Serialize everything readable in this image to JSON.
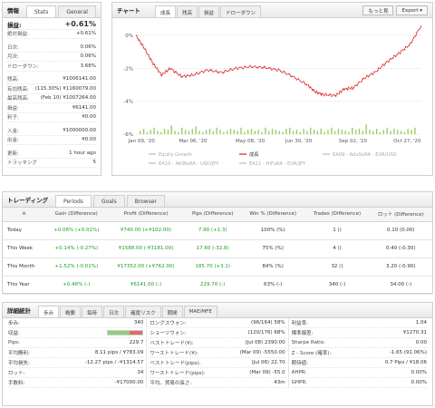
{
  "info": {
    "title": "情報",
    "tabs": [
      "Stats",
      "General"
    ],
    "rows": [
      {
        "k": "損益:",
        "v": "+0.61%",
        "style": "big"
      },
      {
        "k": "絶対損益:",
        "v": "+0.61%",
        "style": "green"
      },
      {
        "k": "",
        "v": "",
        "style": "gap"
      },
      {
        "k": "日次:",
        "v": "0.06%"
      },
      {
        "k": "月次:",
        "v": "0.06%"
      },
      {
        "k": "ドローダウン:",
        "v": "3.68%"
      },
      {
        "k": "",
        "v": "",
        "style": "gap"
      },
      {
        "k": "残高:",
        "v": "¥1006141.00"
      },
      {
        "k": "有効残高:",
        "v": "(115.30%) ¥1160079.00"
      },
      {
        "k": "最高残高:",
        "v": "(Feb 10) ¥1007264.00"
      },
      {
        "k": "損益:",
        "v": "¥6141.00",
        "style": "green"
      },
      {
        "k": "利子:",
        "v": "¥0.00"
      },
      {
        "k": "",
        "v": "",
        "style": "gap"
      },
      {
        "k": "入金:",
        "v": "¥1000000.00"
      },
      {
        "k": "出金:",
        "v": "¥0.00"
      },
      {
        "k": "",
        "v": "",
        "style": "gap"
      },
      {
        "k": "更新:",
        "v": "1 hour ago"
      },
      {
        "k": "トラッキング",
        "v": "5"
      }
    ]
  },
  "chart": {
    "title": "チャート",
    "tabs": [
      "成長",
      "残高",
      "損益",
      "ドローダウン"
    ],
    "tools": [
      "もっと見",
      "Export ▾"
    ],
    "legend": [
      "Equity Growth",
      "成長",
      "EA09 - AduSoRA - EUR/USD",
      "EA10 - AKIBeRA - USD/JPY",
      "EA11 - HiFuRA - EUR/JPY"
    ],
    "colors": {
      "line": "#d8201f",
      "bars": "#9ccc65",
      "grid": "#e6e6e6"
    }
  },
  "chart_data": {
    "type": "line",
    "x_ticks": [
      "Jan 09, '20",
      "Mar 06, '20",
      "May 08, '20",
      "Jun 30, '20",
      "Sep 02, '20",
      "Oct 27, '20"
    ],
    "y_ticks": [
      "0%",
      "-2%",
      "-4%",
      "-6%"
    ],
    "ylim": [
      -6,
      0.61
    ],
    "series": [
      {
        "name": "成長",
        "x": [
          0,
          3,
          6,
          9,
          12,
          16,
          20,
          25,
          30,
          35,
          40,
          45,
          50,
          55,
          60,
          63,
          66,
          70,
          73,
          76,
          80,
          84,
          88,
          92,
          96,
          100
        ],
        "values": [
          0.0,
          -0.8,
          -1.7,
          -2.4,
          -2.0,
          -2.5,
          -2.4,
          -2.1,
          -2.25,
          -2.0,
          -1.9,
          -1.95,
          -2.1,
          -2.5,
          -3.0,
          -3.45,
          -3.6,
          -3.65,
          -3.25,
          -3.2,
          -2.6,
          -2.2,
          -1.6,
          -1.1,
          -0.55,
          0.61
        ]
      }
    ],
    "bars": [
      3,
      5,
      2,
      4,
      6,
      3,
      2,
      5,
      4,
      8,
      3,
      2,
      6,
      4,
      3,
      5,
      7,
      3,
      2,
      4,
      5,
      3,
      6,
      4,
      2,
      3,
      5,
      4,
      3,
      6,
      2,
      4,
      5,
      3,
      4,
      2,
      6,
      3,
      5,
      4,
      3,
      2,
      5,
      6,
      3,
      4,
      2,
      5,
      3,
      6,
      4,
      3,
      5,
      2,
      4,
      6,
      3,
      5,
      4,
      3,
      2,
      6,
      4,
      5,
      3,
      9,
      4,
      3,
      5,
      2,
      4,
      6,
      3,
      5,
      4,
      3,
      2,
      5,
      4,
      6
    ]
  },
  "trading": {
    "title": "トレーディング",
    "tabs": [
      "Periods",
      "Goals",
      "Browser"
    ],
    "headers": [
      "⊕",
      "Gain (Difference)",
      "Profit (Difference)",
      "Pips (Difference)",
      "Win % (Difference)",
      "Trades (Difference)",
      "ロット (Difference)"
    ],
    "rows": [
      [
        "Today",
        "+0.06% (+0.01%)",
        "¥740.00 (+¥102.00)",
        "7.90 (+1.3)",
        "100% (%)",
        "1 ()",
        "0.10 (0.00)"
      ],
      [
        "This Week",
        "+0.14% (-0.27%)",
        "¥1588.00 (-¥3181.00)",
        "17.60 (-32.8)",
        "75% (%)",
        "4 ()",
        "0.40 (-0.30)"
      ],
      [
        "This Month",
        "+1.52% (-0.01%)",
        "¥17352.00 (+¥762.00)",
        "185.70 (+3.1)",
        "84% (%)",
        "32 ()",
        "3.20 (-0.90)"
      ],
      [
        "This Year",
        "+0.46% (-)",
        "¥6141.00 (-)",
        "229.70 (-)",
        "63% (-)",
        "340 (-)",
        "34.00 (-)"
      ]
    ]
  },
  "stats": {
    "title": "詳細統計",
    "tabs": [
      "歩み",
      "概要",
      "毎時",
      "日次",
      "確度リスク",
      "期間",
      "MAE/MFE"
    ],
    "col1": [
      {
        "k": "歩み:",
        "v": "340"
      },
      {
        "k": "収益:",
        "v": "",
        "bar": 0.63
      },
      {
        "k": "Pips:",
        "v": "229.7"
      },
      {
        "k": "平均勝利:",
        "v": "8.11 pips / ¥783.09"
      },
      {
        "k": "平均損失:",
        "v": "-12.27 pips / -¥1314.57"
      },
      {
        "k": "ロット:",
        "v": "34"
      },
      {
        "k": "手数料:",
        "v": "-¥17000.00"
      }
    ],
    "col2": [
      {
        "k": "ロングスウォン:",
        "v": "(96/164) 58%"
      },
      {
        "k": "ショーツウォン:",
        "v": "(120/176) 68%"
      },
      {
        "k": "ベストトレード(¥):",
        "v": "(Jul 08) 2390.00"
      },
      {
        "k": "ワーストトレード(¥):",
        "v": "(Mar 09) -5550.00"
      },
      {
        "k": "ベストトレード(pips):",
        "v": "(Jul 08) 22.70"
      },
      {
        "k": "ワーストトレード(pips):",
        "v": "(Mar 09) -55.0"
      },
      {
        "k": "平均。貿易の長さ:",
        "v": "43m"
      }
    ],
    "col3": [
      {
        "k": "利益率:",
        "v": "1.04"
      },
      {
        "k": "標準偏差:",
        "v": "¥1270.31"
      },
      {
        "k": "Sharpe Ratio:",
        "v": "0.00"
      },
      {
        "k": "Z - Score (確率):",
        "v": "-1.65 (91.06%)"
      },
      {
        "k": "期待値:",
        "v": "0.7 Pips / ¥18.06"
      },
      {
        "k": "AHPR:",
        "v": "0.00%"
      },
      {
        "k": "GHPR:",
        "v": "0.00%"
      }
    ]
  }
}
